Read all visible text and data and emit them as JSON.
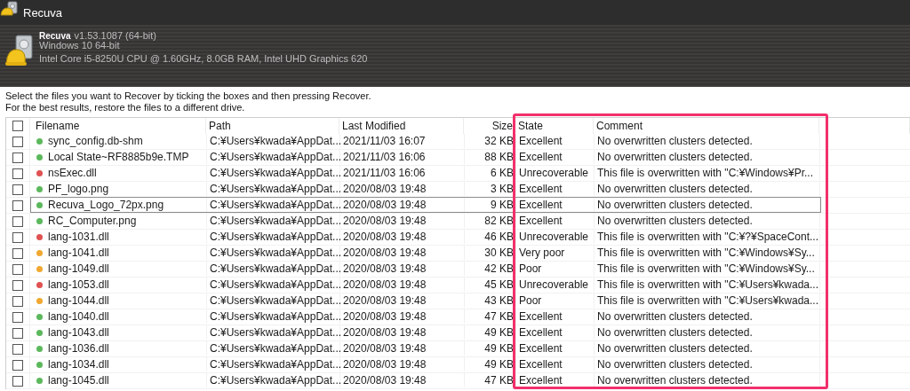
{
  "window": {
    "title": "Recuva"
  },
  "header": {
    "product": "Recuva",
    "version": "v1.53.1087 (64-bit)",
    "os": "Windows 10 64-bit",
    "hardware": "Intel Core i5-8250U CPU @ 1.60GHz, 8.0GB RAM, Intel UHD Graphics 620"
  },
  "instructions": [
    "Select the files you want to Recover by ticking the boxes and then pressing Recover.",
    "For the best results, restore the files to a different drive."
  ],
  "table": {
    "select_all": {
      "checked": false
    },
    "columns": [
      "Filename",
      "Path",
      "Last Modified",
      "Size",
      "State",
      "Comment"
    ],
    "rows": [
      {
        "checked": false,
        "focused": false,
        "color": "#5cb85c",
        "filename": "sync_config.db-shm",
        "path": "C:¥Users¥kwada¥AppDat...",
        "modified": "2021/11/03 16:07",
        "size": "32 KB",
        "state": "Excellent",
        "comment": "No overwritten clusters detected."
      },
      {
        "checked": false,
        "focused": false,
        "color": "#5cb85c",
        "filename": "Local State~RF8885b9e.TMP",
        "path": "C:¥Users¥kwada¥AppDat...",
        "modified": "2021/11/03 16:06",
        "size": "88 KB",
        "state": "Excellent",
        "comment": "No overwritten clusters detected."
      },
      {
        "checked": false,
        "focused": false,
        "color": "#e05252",
        "filename": "nsExec.dll",
        "path": "C:¥Users¥kwada¥AppDat...",
        "modified": "2021/11/03 16:06",
        "size": "6 KB",
        "state": "Unrecoverable",
        "comment": "This file is overwritten with \"C:¥Windows¥Pr..."
      },
      {
        "checked": false,
        "focused": false,
        "color": "#5cb85c",
        "filename": "PF_logo.png",
        "path": "C:¥Users¥kwada¥AppDat...",
        "modified": "2020/08/03 19:48",
        "size": "3 KB",
        "state": "Excellent",
        "comment": "No overwritten clusters detected."
      },
      {
        "checked": false,
        "focused": true,
        "color": "#5cb85c",
        "filename": "Recuva_Logo_72px.png",
        "path": "C:¥Users¥kwada¥AppDat...",
        "modified": "2020/08/03 19:48",
        "size": "9 KB",
        "state": "Excellent",
        "comment": "No overwritten clusters detected."
      },
      {
        "checked": false,
        "focused": false,
        "color": "#5cb85c",
        "filename": "RC_Computer.png",
        "path": "C:¥Users¥kwada¥AppDat...",
        "modified": "2020/08/03 19:48",
        "size": "82 KB",
        "state": "Excellent",
        "comment": "No overwritten clusters detected."
      },
      {
        "checked": false,
        "focused": false,
        "color": "#e05252",
        "filename": "lang-1031.dll",
        "path": "C:¥Users¥kwada¥AppDat...",
        "modified": "2020/08/03 19:48",
        "size": "46 KB",
        "state": "Unrecoverable",
        "comment": "This file is overwritten with \"C:¥?¥SpaceCont..."
      },
      {
        "checked": false,
        "focused": false,
        "color": "#f0a830",
        "filename": "lang-1041.dll",
        "path": "C:¥Users¥kwada¥AppDat...",
        "modified": "2020/08/03 19:48",
        "size": "30 KB",
        "state": "Very poor",
        "comment": "This file is overwritten with \"C:¥Windows¥Sy..."
      },
      {
        "checked": false,
        "focused": false,
        "color": "#f0a830",
        "filename": "lang-1049.dll",
        "path": "C:¥Users¥kwada¥AppDat...",
        "modified": "2020/08/03 19:48",
        "size": "42 KB",
        "state": "Poor",
        "comment": "This file is overwritten with \"C:¥Windows¥Sy..."
      },
      {
        "checked": false,
        "focused": false,
        "color": "#e05252",
        "filename": "lang-1053.dll",
        "path": "C:¥Users¥kwada¥AppDat...",
        "modified": "2020/08/03 19:48",
        "size": "45 KB",
        "state": "Unrecoverable",
        "comment": "This file is overwritten with \"C:¥Users¥kwada..."
      },
      {
        "checked": false,
        "focused": false,
        "color": "#f0a830",
        "filename": "lang-1044.dll",
        "path": "C:¥Users¥kwada¥AppDat...",
        "modified": "2020/08/03 19:48",
        "size": "43 KB",
        "state": "Poor",
        "comment": "This file is overwritten with \"C:¥Users¥kwada..."
      },
      {
        "checked": false,
        "focused": false,
        "color": "#5cb85c",
        "filename": "lang-1040.dll",
        "path": "C:¥Users¥kwada¥AppDat...",
        "modified": "2020/08/03 19:48",
        "size": "47 KB",
        "state": "Excellent",
        "comment": "No overwritten clusters detected."
      },
      {
        "checked": false,
        "focused": false,
        "color": "#5cb85c",
        "filename": "lang-1043.dll",
        "path": "C:¥Users¥kwada¥AppDat...",
        "modified": "2020/08/03 19:48",
        "size": "49 KB",
        "state": "Excellent",
        "comment": "No overwritten clusters detected."
      },
      {
        "checked": false,
        "focused": false,
        "color": "#5cb85c",
        "filename": "lang-1036.dll",
        "path": "C:¥Users¥kwada¥AppDat...",
        "modified": "2020/08/03 19:48",
        "size": "49 KB",
        "state": "Excellent",
        "comment": "No overwritten clusters detected."
      },
      {
        "checked": false,
        "focused": false,
        "color": "#5cb85c",
        "filename": "lang-1034.dll",
        "path": "C:¥Users¥kwada¥AppDat...",
        "modified": "2020/08/03 19:48",
        "size": "49 KB",
        "state": "Excellent",
        "comment": "No overwritten clusters detected."
      },
      {
        "checked": false,
        "focused": false,
        "color": "#5cb85c",
        "filename": "lang-1045.dll",
        "path": "C:¥Users¥kwada¥AppDat...",
        "modified": "2020/08/03 19:48",
        "size": "47 KB",
        "state": "Excellent",
        "comment": "No overwritten clusters detected."
      }
    ]
  }
}
